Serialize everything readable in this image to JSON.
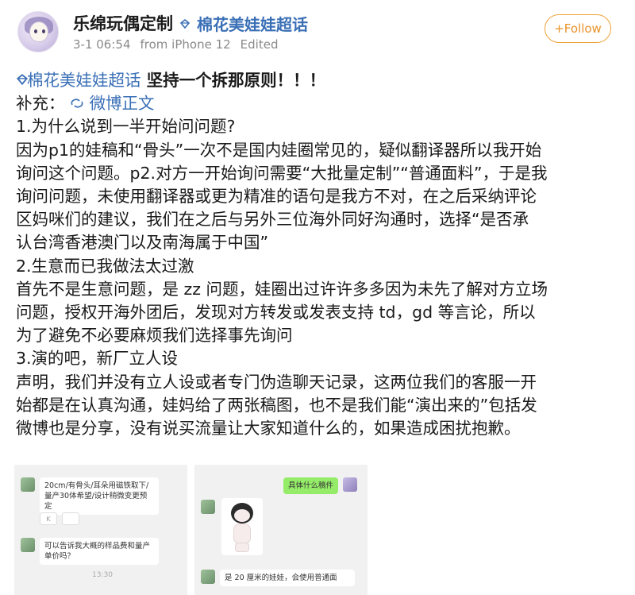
{
  "header": {
    "username": "乐绵玩偶定制",
    "topic": "棉花美娃娃超话",
    "time": "3-1 06:54",
    "source": "from iPhone 12",
    "edited": "Edited",
    "follow_label": "+Follow"
  },
  "post": {
    "title_topic": "棉花美娃娃超话",
    "title_text": " 坚持一个拆那原则！！！",
    "supplement_label": "补充：",
    "supplement_link": "微博正文",
    "lines": [
      "1.为什么说到一半开始问问题?",
      "因为p1的娃稿和“骨头”一次不是国内娃圈常见的，疑似翻译器所以我开始",
      "询问这个问题。p2.对方一开始询问需要“大批量定制”“普通面料”，于是我",
      "询问问题，未使用翻译器或更为精准的语句是我方不对，在之后采纳评论",
      "区妈咪们的建议，我们在之后与另外三位海外同好沟通时，选择“是否承",
      "认台湾香港澳门以及南海属于中国”",
      "2.生意而已我做法太过激",
      "首先不是生意问题，是 zz 问题，娃圈出过许许多多因为未先了解对方立场",
      "问题，授权开海外团后，发现对方转发或发表支持 td，gd 等言论，所以",
      "为了避免不必要麻烦我们选择事先询问",
      "3.演的吧，新厂立人设",
      "声明，我们并没有立人设或者专门伪造聊天记录，这两位我们的客服一开",
      "始都是在认真沟通，娃妈给了两张稿图，也不是我们能“演出来的”包括发",
      "微博也是分享，没有说买流量让大家知道什么的，如果造成困扰抱歉。"
    ]
  },
  "screenshot_left": {
    "msg1": "20cm/有骨头/耳朵用磁铁取下/量产30体希望/设计稍微变更预定",
    "sticker": "K",
    "msg2": "可以告诉我大概的样品费和量产单价吗？",
    "time": "13:30"
  },
  "screenshot_right": {
    "msg_green": "具体什么稿件",
    "msg_bottom": "是 20 厘米的娃娃，会使用普通面"
  },
  "colors": {
    "link": "#3a6fb6",
    "follow": "#e8932a",
    "meta": "#8a8a8a"
  }
}
